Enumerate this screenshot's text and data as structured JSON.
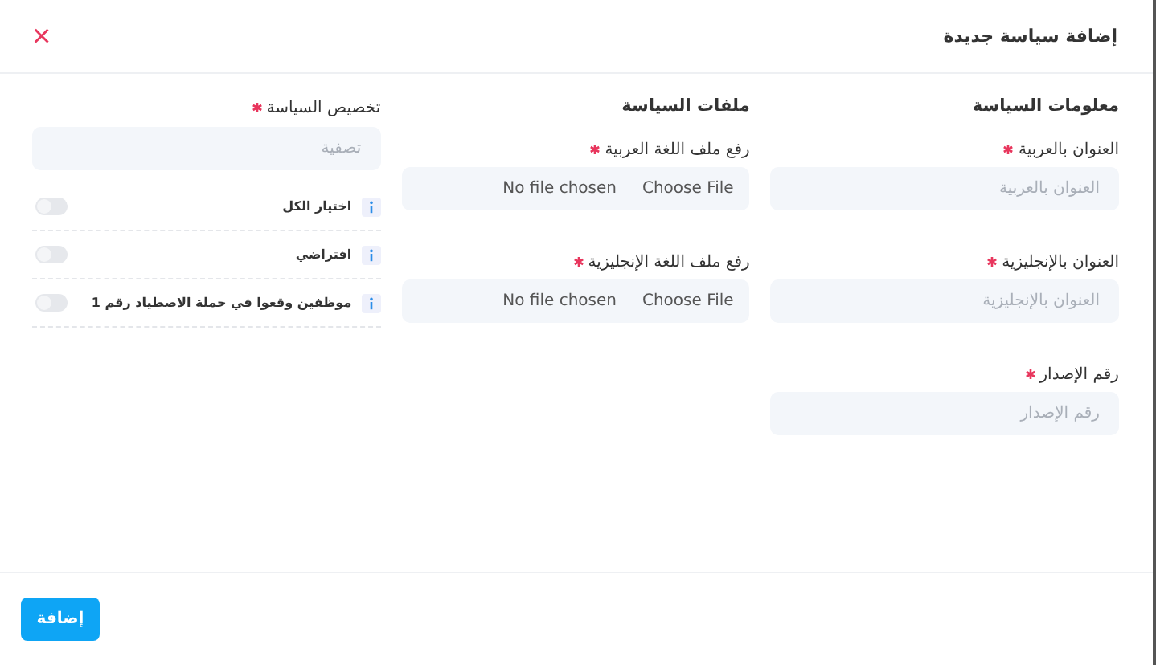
{
  "dialog": {
    "title": "إضافة سياسة جديدة",
    "close": "×"
  },
  "info_section": {
    "title": "معلومات السياسة",
    "fields": [
      {
        "label": "العنوان بالعربية",
        "required": true,
        "placeholder": "العنوان بالعربية"
      },
      {
        "label": "العنوان بالإنجليزية",
        "required": true,
        "placeholder": "العنوان بالإنجليزية"
      },
      {
        "label": "رقم الإصدار",
        "required": true,
        "placeholder": "رقم الإصدار"
      }
    ]
  },
  "files_section": {
    "title": "ملفات السياسة",
    "uploads": [
      {
        "label": "رفع ملف اللغة العربية",
        "required": true,
        "button": "Choose File",
        "status": "No file chosen"
      },
      {
        "label": "رفع ملف اللغة الإنجليزية",
        "required": true,
        "button": "Choose File",
        "status": "No file chosen"
      }
    ]
  },
  "assignment": {
    "label": "تخصيص السياسة",
    "required": true,
    "filter_placeholder": "تصفية",
    "options": [
      {
        "label": "اختيار الكل",
        "on": false
      },
      {
        "label": "افتراضي",
        "on": false
      },
      {
        "label": "موظفين وقعوا في حملة الاصطياد رقم 1",
        "on": false
      }
    ]
  },
  "footer": {
    "submit": "إضافة"
  }
}
